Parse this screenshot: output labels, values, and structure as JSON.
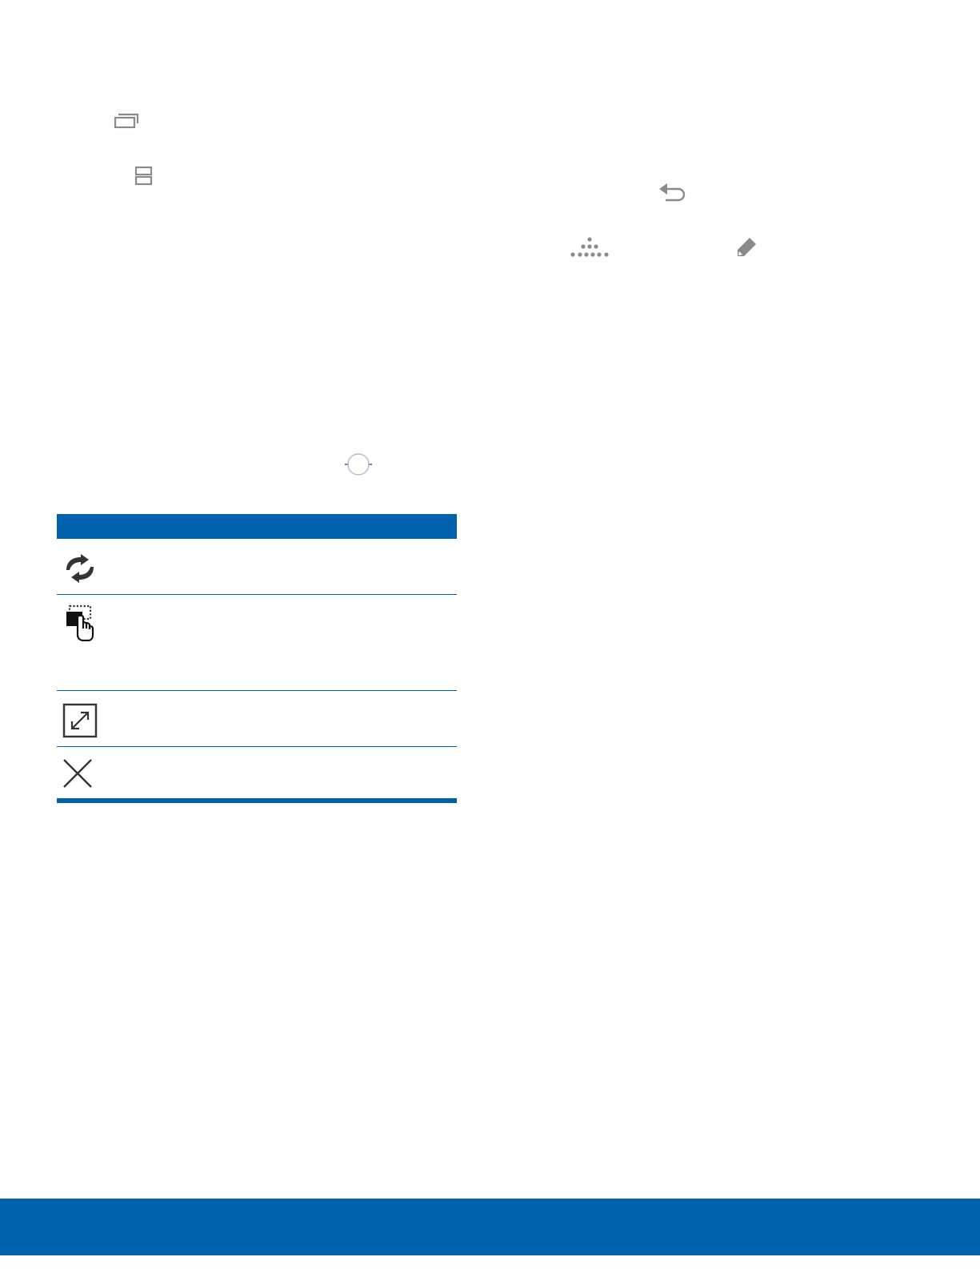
{
  "icons": {
    "recent_apps": "recent-apps-icon",
    "split_screen": "split-screen-icon",
    "back": "back-icon",
    "apps_dots": "apps-grid-dots-icon",
    "edit": "pencil-icon",
    "window_handle": "window-divider-handle-icon"
  },
  "table": {
    "header": "",
    "rows": [
      {
        "icon": "swap-windows-icon",
        "text": ""
      },
      {
        "icon": "drag-content-icon",
        "text": ""
      },
      {
        "icon": "maximize-window-icon",
        "text": ""
      },
      {
        "icon": "close-app-icon",
        "text": ""
      }
    ]
  },
  "colors": {
    "accent": "#0061ad",
    "icon_gray": "#8a8a8a",
    "icon_dark": "#333333"
  }
}
